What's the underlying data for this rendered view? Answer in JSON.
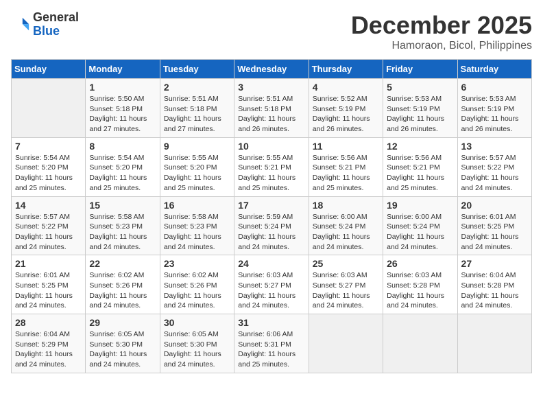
{
  "logo": {
    "general": "General",
    "blue": "Blue"
  },
  "header": {
    "month": "December 2025",
    "location": "Hamoraon, Bicol, Philippines"
  },
  "weekdays": [
    "Sunday",
    "Monday",
    "Tuesday",
    "Wednesday",
    "Thursday",
    "Friday",
    "Saturday"
  ],
  "weeks": [
    [
      {
        "day": "",
        "sunrise": "",
        "sunset": "",
        "daylight": ""
      },
      {
        "day": "1",
        "sunrise": "Sunrise: 5:50 AM",
        "sunset": "Sunset: 5:18 PM",
        "daylight": "Daylight: 11 hours and 27 minutes."
      },
      {
        "day": "2",
        "sunrise": "Sunrise: 5:51 AM",
        "sunset": "Sunset: 5:18 PM",
        "daylight": "Daylight: 11 hours and 27 minutes."
      },
      {
        "day": "3",
        "sunrise": "Sunrise: 5:51 AM",
        "sunset": "Sunset: 5:18 PM",
        "daylight": "Daylight: 11 hours and 26 minutes."
      },
      {
        "day": "4",
        "sunrise": "Sunrise: 5:52 AM",
        "sunset": "Sunset: 5:19 PM",
        "daylight": "Daylight: 11 hours and 26 minutes."
      },
      {
        "day": "5",
        "sunrise": "Sunrise: 5:53 AM",
        "sunset": "Sunset: 5:19 PM",
        "daylight": "Daylight: 11 hours and 26 minutes."
      },
      {
        "day": "6",
        "sunrise": "Sunrise: 5:53 AM",
        "sunset": "Sunset: 5:19 PM",
        "daylight": "Daylight: 11 hours and 26 minutes."
      }
    ],
    [
      {
        "day": "7",
        "sunrise": "Sunrise: 5:54 AM",
        "sunset": "Sunset: 5:20 PM",
        "daylight": "Daylight: 11 hours and 25 minutes."
      },
      {
        "day": "8",
        "sunrise": "Sunrise: 5:54 AM",
        "sunset": "Sunset: 5:20 PM",
        "daylight": "Daylight: 11 hours and 25 minutes."
      },
      {
        "day": "9",
        "sunrise": "Sunrise: 5:55 AM",
        "sunset": "Sunset: 5:20 PM",
        "daylight": "Daylight: 11 hours and 25 minutes."
      },
      {
        "day": "10",
        "sunrise": "Sunrise: 5:55 AM",
        "sunset": "Sunset: 5:21 PM",
        "daylight": "Daylight: 11 hours and 25 minutes."
      },
      {
        "day": "11",
        "sunrise": "Sunrise: 5:56 AM",
        "sunset": "Sunset: 5:21 PM",
        "daylight": "Daylight: 11 hours and 25 minutes."
      },
      {
        "day": "12",
        "sunrise": "Sunrise: 5:56 AM",
        "sunset": "Sunset: 5:21 PM",
        "daylight": "Daylight: 11 hours and 25 minutes."
      },
      {
        "day": "13",
        "sunrise": "Sunrise: 5:57 AM",
        "sunset": "Sunset: 5:22 PM",
        "daylight": "Daylight: 11 hours and 24 minutes."
      }
    ],
    [
      {
        "day": "14",
        "sunrise": "Sunrise: 5:57 AM",
        "sunset": "Sunset: 5:22 PM",
        "daylight": "Daylight: 11 hours and 24 minutes."
      },
      {
        "day": "15",
        "sunrise": "Sunrise: 5:58 AM",
        "sunset": "Sunset: 5:23 PM",
        "daylight": "Daylight: 11 hours and 24 minutes."
      },
      {
        "day": "16",
        "sunrise": "Sunrise: 5:58 AM",
        "sunset": "Sunset: 5:23 PM",
        "daylight": "Daylight: 11 hours and 24 minutes."
      },
      {
        "day": "17",
        "sunrise": "Sunrise: 5:59 AM",
        "sunset": "Sunset: 5:24 PM",
        "daylight": "Daylight: 11 hours and 24 minutes."
      },
      {
        "day": "18",
        "sunrise": "Sunrise: 6:00 AM",
        "sunset": "Sunset: 5:24 PM",
        "daylight": "Daylight: 11 hours and 24 minutes."
      },
      {
        "day": "19",
        "sunrise": "Sunrise: 6:00 AM",
        "sunset": "Sunset: 5:24 PM",
        "daylight": "Daylight: 11 hours and 24 minutes."
      },
      {
        "day": "20",
        "sunrise": "Sunrise: 6:01 AM",
        "sunset": "Sunset: 5:25 PM",
        "daylight": "Daylight: 11 hours and 24 minutes."
      }
    ],
    [
      {
        "day": "21",
        "sunrise": "Sunrise: 6:01 AM",
        "sunset": "Sunset: 5:25 PM",
        "daylight": "Daylight: 11 hours and 24 minutes."
      },
      {
        "day": "22",
        "sunrise": "Sunrise: 6:02 AM",
        "sunset": "Sunset: 5:26 PM",
        "daylight": "Daylight: 11 hours and 24 minutes."
      },
      {
        "day": "23",
        "sunrise": "Sunrise: 6:02 AM",
        "sunset": "Sunset: 5:26 PM",
        "daylight": "Daylight: 11 hours and 24 minutes."
      },
      {
        "day": "24",
        "sunrise": "Sunrise: 6:03 AM",
        "sunset": "Sunset: 5:27 PM",
        "daylight": "Daylight: 11 hours and 24 minutes."
      },
      {
        "day": "25",
        "sunrise": "Sunrise: 6:03 AM",
        "sunset": "Sunset: 5:27 PM",
        "daylight": "Daylight: 11 hours and 24 minutes."
      },
      {
        "day": "26",
        "sunrise": "Sunrise: 6:03 AM",
        "sunset": "Sunset: 5:28 PM",
        "daylight": "Daylight: 11 hours and 24 minutes."
      },
      {
        "day": "27",
        "sunrise": "Sunrise: 6:04 AM",
        "sunset": "Sunset: 5:28 PM",
        "daylight": "Daylight: 11 hours and 24 minutes."
      }
    ],
    [
      {
        "day": "28",
        "sunrise": "Sunrise: 6:04 AM",
        "sunset": "Sunset: 5:29 PM",
        "daylight": "Daylight: 11 hours and 24 minutes."
      },
      {
        "day": "29",
        "sunrise": "Sunrise: 6:05 AM",
        "sunset": "Sunset: 5:30 PM",
        "daylight": "Daylight: 11 hours and 24 minutes."
      },
      {
        "day": "30",
        "sunrise": "Sunrise: 6:05 AM",
        "sunset": "Sunset: 5:30 PM",
        "daylight": "Daylight: 11 hours and 24 minutes."
      },
      {
        "day": "31",
        "sunrise": "Sunrise: 6:06 AM",
        "sunset": "Sunset: 5:31 PM",
        "daylight": "Daylight: 11 hours and 25 minutes."
      },
      {
        "day": "",
        "sunrise": "",
        "sunset": "",
        "daylight": ""
      },
      {
        "day": "",
        "sunrise": "",
        "sunset": "",
        "daylight": ""
      },
      {
        "day": "",
        "sunrise": "",
        "sunset": "",
        "daylight": ""
      }
    ]
  ]
}
